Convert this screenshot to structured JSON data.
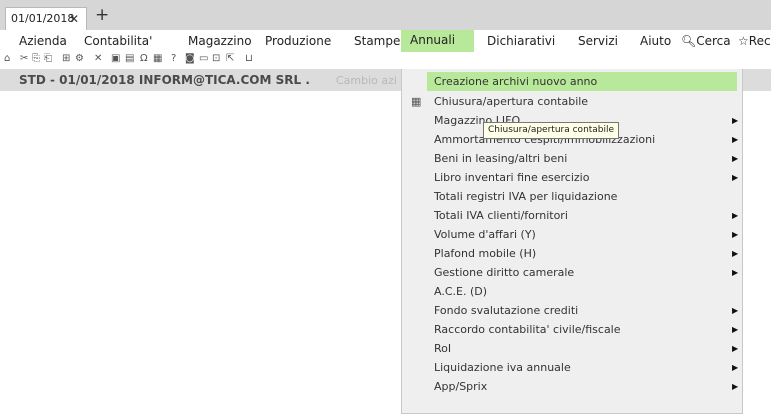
{
  "tab": {
    "title": "01/01/2018",
    "close": "✕",
    "new": "+"
  },
  "menubar": [
    {
      "label": "Azienda"
    },
    {
      "label": "Contabilita'"
    },
    {
      "label": "Magazzino"
    },
    {
      "label": "Produzione"
    },
    {
      "label": "Stampe"
    },
    {
      "label": "Annuali"
    },
    {
      "label": "Dichiarativi"
    },
    {
      "label": "Servizi"
    },
    {
      "label": "Aiuto"
    },
    {
      "label": "Cerca"
    },
    {
      "label": "Rec"
    }
  ],
  "toolbar_icons": [
    "home-icon",
    "cut-icon",
    "copy-icon",
    "paste-icon",
    "tree-icon",
    "tools-icon",
    "close-x-icon",
    "window-icon",
    "window2-icon",
    "omega-icon",
    "calc-icon",
    "help-icon",
    "help2-icon",
    "doc-icon",
    "docs-icon",
    "export-icon",
    "cart-icon"
  ],
  "status": {
    "company": "STD - 01/01/2018  INFORM@TICA.COM SRL .",
    "change_company": "Cambio azi"
  },
  "dropdown": {
    "items": [
      {
        "label": "Creazione archivi nuovo anno",
        "submenu": false
      },
      {
        "label": "Chiusura/apertura contabile",
        "submenu": false,
        "icon": "calendar-icon"
      },
      {
        "label": "Magazzino LIFO",
        "submenu": true
      },
      {
        "label": "Ammortamento cespiti/immobilizzazioni",
        "submenu": true
      },
      {
        "label": "Beni in leasing/altri beni",
        "submenu": true
      },
      {
        "label": "Libro inventari fine esercizio",
        "submenu": true
      },
      {
        "label": "Totali registri IVA per liquidazione",
        "submenu": false
      },
      {
        "label": "Totali IVA clienti/fornitori",
        "submenu": true
      },
      {
        "label": "Volume d'affari (Y)",
        "submenu": true
      },
      {
        "label": "Plafond mobile (H)",
        "submenu": true
      },
      {
        "label": "Gestione diritto camerale",
        "submenu": true
      },
      {
        "label": "A.C.E. (D)",
        "submenu": false
      },
      {
        "label": "Fondo svalutazione crediti",
        "submenu": true
      },
      {
        "label": "Raccordo contabilita' civile/fiscale",
        "submenu": true
      },
      {
        "label": "RoI",
        "submenu": true
      },
      {
        "label": "Liquidazione iva annuale",
        "submenu": true
      },
      {
        "label": "App/Sprix",
        "submenu": true
      }
    ],
    "tooltip": "Chiusura/apertura contabile"
  },
  "colors": {
    "highlight": "#b8e89a",
    "menu_bg": "#efefef",
    "tabbar_bg": "#d6d6d6"
  }
}
